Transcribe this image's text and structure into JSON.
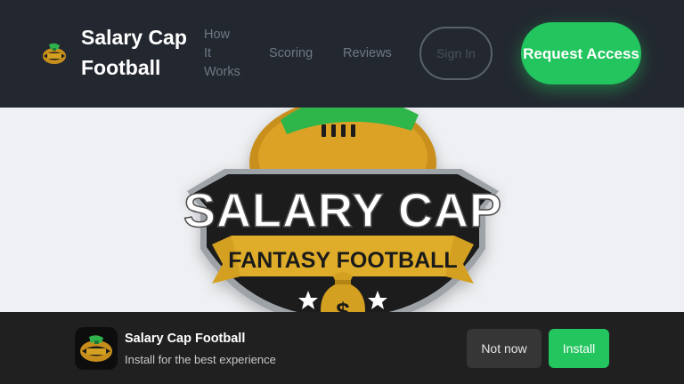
{
  "header": {
    "brand_title": "Salary Cap Football",
    "nav": {
      "how_it_works": "How It Works",
      "scoring": "Scoring",
      "reviews": "Reviews"
    },
    "sign_in": "Sign In",
    "request_access": "Request Access"
  },
  "hero": {
    "logo_line1": "SALARY CAP",
    "logo_line2": "FANTASY FOOTBALL",
    "money_symbol": "$"
  },
  "install_banner": {
    "app_name": "Salary Cap Football",
    "subtitle": "Install for the best experience",
    "not_now": "Not now",
    "install": "Install"
  },
  "colors": {
    "header_bg": "#232830",
    "accent_green": "#22c55e",
    "banner_bg": "#202020",
    "logo_gold": "#d4a021",
    "logo_black": "#1a1a1a"
  }
}
